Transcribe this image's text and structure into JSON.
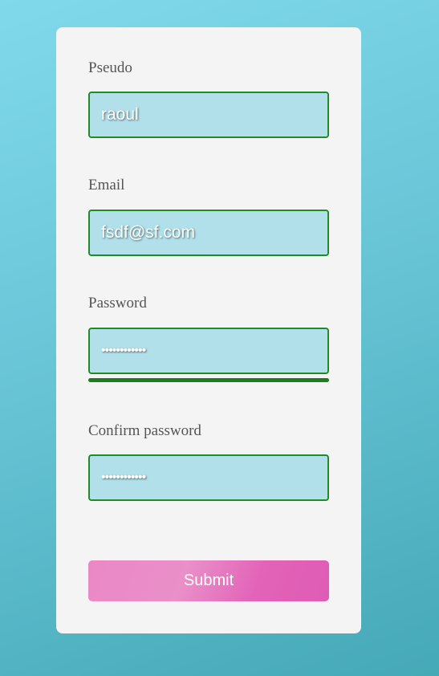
{
  "form": {
    "pseudo": {
      "label": "Pseudo",
      "value": "raoul"
    },
    "email": {
      "label": "Email",
      "value": "fsdf@sf.com"
    },
    "password": {
      "label": "Password",
      "value": "••••••••••••",
      "strength_percent": 100,
      "strength_color": "#1d7d1d"
    },
    "confirm_password": {
      "label": "Confirm password",
      "value": "••••••••••••"
    },
    "submit_label": "Submit"
  },
  "colors": {
    "input_border": "#238a2a",
    "input_background": "#b1e0ea",
    "card_background": "#f4f4f4",
    "button_gradient_start": "#ea88c6",
    "button_gradient_end": "#df5cb4"
  }
}
